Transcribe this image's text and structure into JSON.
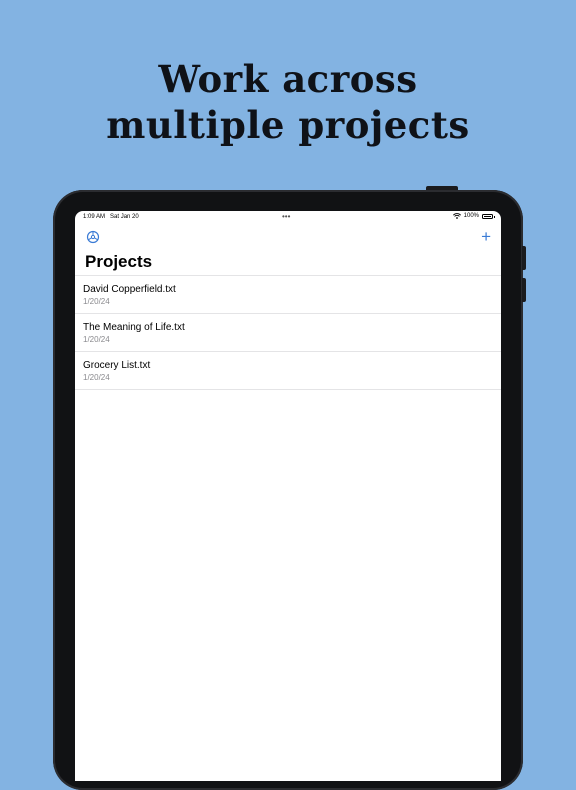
{
  "headline": {
    "line1": "Work across",
    "line2": "multiple projects"
  },
  "status_bar": {
    "time": "1:09 AM",
    "date": "Sat Jan 20",
    "dots": "•••",
    "battery_text": "100%"
  },
  "toolbar": {
    "settings_icon": "gear-icon",
    "add_label": "+"
  },
  "page": {
    "title": "Projects"
  },
  "projects": [
    {
      "name": "David Copperfield.txt",
      "date": "1/20/24"
    },
    {
      "name": "The Meaning of Life.txt",
      "date": "1/20/24"
    },
    {
      "name": "Grocery List.txt",
      "date": "1/20/24"
    }
  ],
  "colors": {
    "background": "#83b3e2",
    "accent": "#3a7bd5",
    "device_frame": "#111214",
    "secondary_text": "#8a8a8e"
  }
}
